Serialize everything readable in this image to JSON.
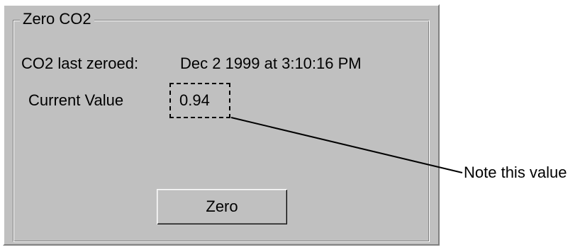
{
  "groupbox": {
    "title": "Zero CO2"
  },
  "last_zeroed": {
    "label": "CO2 last zeroed:",
    "value": "Dec 2 1999 at 3:10:16 PM"
  },
  "current_value": {
    "label": "Current Value",
    "value": "0.94"
  },
  "buttons": {
    "zero_label": "Zero"
  },
  "annotation": {
    "text": "Note this value"
  }
}
